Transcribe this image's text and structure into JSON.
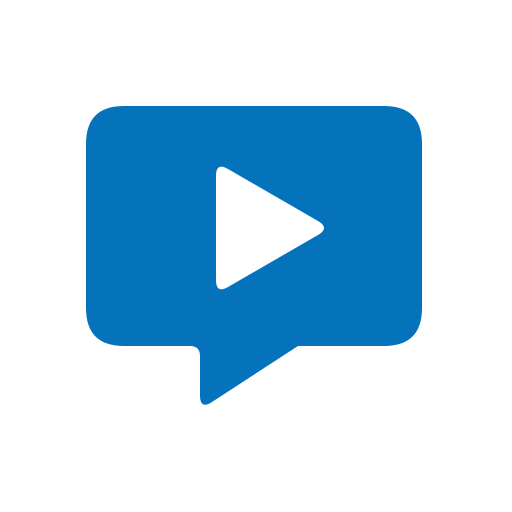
{
  "icon": {
    "name": "video-chat-bubble-icon",
    "parts": [
      "speech-bubble",
      "play-triangle"
    ],
    "colors": {
      "bubble": "#0473BC",
      "play": "#ffffff",
      "background": "#ffffff"
    }
  }
}
